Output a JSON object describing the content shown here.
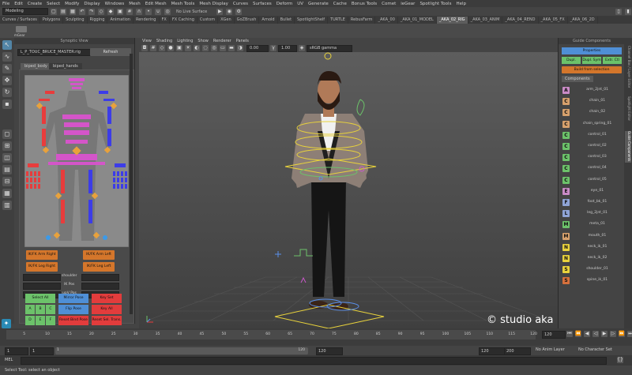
{
  "menubar": [
    "File",
    "Edit",
    "Create",
    "Select",
    "Modify",
    "Display",
    "Windows",
    "Mesh",
    "Edit Mesh",
    "Mesh Tools",
    "Mesh Display",
    "Curves",
    "Surfaces",
    "Deform",
    "UV",
    "Generate",
    "Cache",
    "Bonus Tools",
    "Comet",
    "ieGear",
    "Spotlight Tools",
    "Help"
  ],
  "status": {
    "mode": "Modeling",
    "live_surface": "No Live Surface"
  },
  "shelf_tabs": [
    "Curves / Surfaces",
    "Polygons",
    "Sculpting",
    "Rigging",
    "Animation",
    "Rendering",
    "FX",
    "FX Caching",
    "Custom",
    "XGen",
    "GoZBrush",
    "Arnold",
    "Bullet",
    "SpotlightShelf",
    "TURTLE",
    "RebusFarm",
    "_AKA_00",
    "_AKA_01_MODEL",
    "_AKA_02_RIG",
    "_AKA_03_ANIM",
    "_AKA_04_REND",
    "_AKA_05_FX",
    "_AKA_06_2D"
  ],
  "active_shelf": "_AKA_02_RIG",
  "shelf_button_label": "mGear",
  "synoptic": {
    "title": "Synoptic View",
    "rig_select": "L_P_TOUC_BRUCE_MASTER:rig",
    "refresh": "Refresh",
    "tabs": [
      "biped_body",
      "biped_hands"
    ],
    "ik_fk": [
      "IK/FK Arm Right",
      "IK/FK Arm Left",
      "IK/FK Leg Right",
      "IK/FK Leg Left"
    ],
    "dropdown_labels": [
      "shoulder",
      "IK Pos",
      "upV Pos"
    ],
    "actions": {
      "select_all": "Select All",
      "mirror_pose": "Mirror Pose",
      "key_set": "Key Set",
      "a": "A",
      "b": "B",
      "c": "C",
      "d": "D",
      "e": "E",
      "f": "F",
      "flip_pose": "Flip Pose",
      "key_all": "Key All",
      "reset_bind": "Reset Bind Pose",
      "reset_sel": "Reset Sel. Trans."
    }
  },
  "viewport": {
    "menus": [
      "View",
      "Shading",
      "Lighting",
      "Show",
      "Renderer",
      "Panels"
    ],
    "field_a": "0.00",
    "field_b": "1.00",
    "color_space": "sRGB gamma",
    "watermark": "© studio aka"
  },
  "guide": {
    "title": "Guide Components",
    "properties": "Properties",
    "dupl": "Dupl.",
    "dupl_sym": "Dupl. Sym",
    "extr_ctl": "Extr. Ctl",
    "build": "Build from selection",
    "components_tab": "Components",
    "components": [
      {
        "letter": "A",
        "color": "#c98bc6",
        "name": "arm_2jnt_01"
      },
      {
        "letter": "C",
        "color": "#d6a06c",
        "name": "chain_01"
      },
      {
        "letter": "C",
        "color": "#d6a06c",
        "name": "chain_02"
      },
      {
        "letter": "C",
        "color": "#d6a06c",
        "name": "chain_spring_01"
      },
      {
        "letter": "C",
        "color": "#6cc26a",
        "name": "control_01"
      },
      {
        "letter": "C",
        "color": "#6cc26a",
        "name": "control_02"
      },
      {
        "letter": "C",
        "color": "#6cc26a",
        "name": "control_03"
      },
      {
        "letter": "C",
        "color": "#6cc26a",
        "name": "control_04"
      },
      {
        "letter": "C",
        "color": "#6cc26a",
        "name": "control_05"
      },
      {
        "letter": "E",
        "color": "#c98bc6",
        "name": "eye_01"
      },
      {
        "letter": "F",
        "color": "#8fa4d6",
        "name": "foot_bk_01"
      },
      {
        "letter": "L",
        "color": "#8fa4d6",
        "name": "leg_2jnt_01"
      },
      {
        "letter": "M",
        "color": "#6cc26a",
        "name": "meta_01"
      },
      {
        "letter": "M",
        "color": "#d6a06c",
        "name": "mouth_01"
      },
      {
        "letter": "N",
        "color": "#e8d23c",
        "name": "neck_ik_01"
      },
      {
        "letter": "N",
        "color": "#e8d23c",
        "name": "neck_ik_02"
      },
      {
        "letter": "S",
        "color": "#e8d23c",
        "name": "shoulder_01"
      },
      {
        "letter": "S",
        "color": "#d6703c",
        "name": "spine_ik_01"
      }
    ]
  },
  "side_tabs": [
    "Channel Box / Layer Editor",
    "Spotlight Editor",
    "Guide Components"
  ],
  "timeline": {
    "ticks": [
      "5",
      "10",
      "15",
      "20",
      "25",
      "30",
      "35",
      "40",
      "45",
      "50",
      "55",
      "60",
      "65",
      "70",
      "75",
      "80",
      "85",
      "90",
      "95",
      "100",
      "105",
      "110",
      "115",
      "120"
    ],
    "current": "120"
  },
  "range": {
    "start": "1",
    "start2": "1",
    "inner_start": "1",
    "inner_end": "120",
    "end": "120",
    "end2": "120",
    "end3": "200",
    "anim_layer": "No Anim Layer",
    "char_set": "No Character Set"
  },
  "cmd": {
    "label": "MEL"
  },
  "help": "Select Tool: select an object"
}
